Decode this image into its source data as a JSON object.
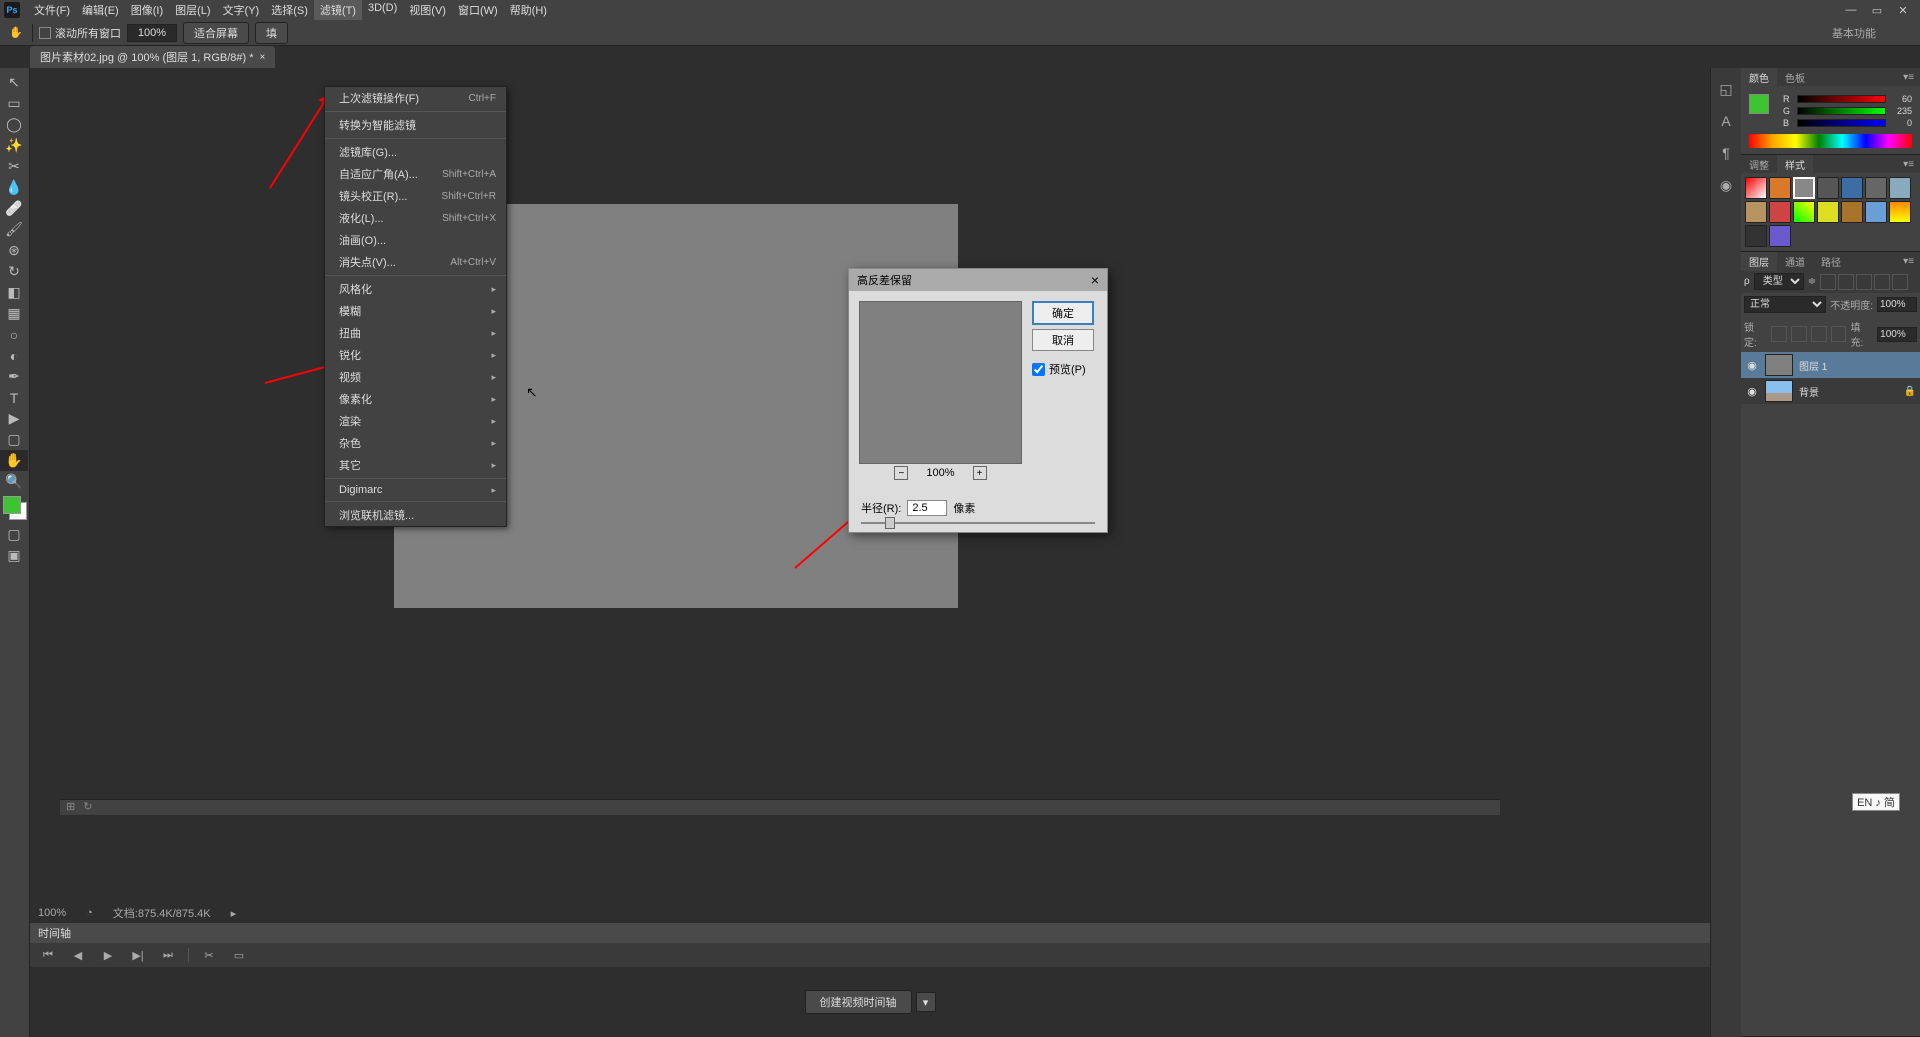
{
  "menu": {
    "file": "文件(F)",
    "edit": "编辑(E)",
    "image": "图像(I)",
    "layer": "图层(L)",
    "type": "文字(Y)",
    "select": "选择(S)",
    "filter": "滤镜(T)",
    "3d": "3D(D)",
    "view": "视图(V)",
    "window": "窗口(W)",
    "help": "帮助(H)"
  },
  "options": {
    "scroll_all": "滚动所有窗口",
    "zoom_value": "100%",
    "fit_screen": "适合屏幕",
    "fill_screen": "填",
    "workspace": "基本功能"
  },
  "doc_tab": {
    "title": "图片素材02.jpg @ 100% (图层 1, RGB/8#) *"
  },
  "filter_menu": {
    "last": "上次滤镜操作(F)",
    "last_shortcut": "Ctrl+F",
    "convert_smart": "转换为智能滤镜",
    "gallery": "滤镜库(G)...",
    "adaptive": "自适应广角(A)...",
    "adaptive_sc": "Shift+Ctrl+A",
    "lens": "镜头校正(R)...",
    "lens_sc": "Shift+Ctrl+R",
    "liquify": "液化(L)...",
    "liquify_sc": "Shift+Ctrl+X",
    "oilpaint": "油画(O)...",
    "vanishing": "消失点(V)...",
    "vanishing_sc": "Alt+Ctrl+V",
    "stylize": "风格化",
    "blur": "模糊",
    "distort": "扭曲",
    "sharpen": "锐化",
    "video": "视频",
    "pixelate": "像素化",
    "render": "渲染",
    "noise": "杂色",
    "other": "其它",
    "digimarc": "Digimarc",
    "browse": "浏览联机滤镜..."
  },
  "dialog": {
    "title": "高反差保留",
    "ok": "确定",
    "cancel": "取消",
    "preview": "预览(P)",
    "zoom": "100%",
    "radius_label": "半径(R):",
    "radius_value": "2.5",
    "radius_unit": "像素"
  },
  "panels": {
    "color_tab": "颜色",
    "swatches_tab": "色板",
    "r": "R",
    "r_val": "60",
    "g": "G",
    "g_val": "235",
    "b": "B",
    "b_val": "0",
    "adjust_tab": "调整",
    "styles_tab": "样式",
    "layers_tab": "图层",
    "channels_tab": "通道",
    "paths_tab": "路径",
    "kind_label": "类型",
    "blend_mode": "正常",
    "opacity_label": "不透明度:",
    "opacity_val": "100%",
    "lock_label": "锁定:",
    "fill_label": "填充:",
    "fill_val": "100%",
    "layer1": "图层 1",
    "bg_layer": "背景"
  },
  "status": {
    "zoom": "100%",
    "docsize": "文档:875.4K/875.4K"
  },
  "timeline": {
    "tab": "时间轴",
    "create_btn": "创建视频时间轴"
  },
  "ime": "EN ♪ 简"
}
